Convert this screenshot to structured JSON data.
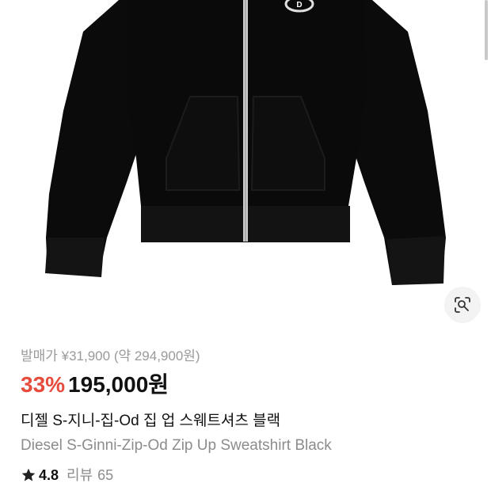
{
  "product": {
    "image_alt": "Diesel S-Ginni-Zip-Od black zip-up sweatshirt",
    "release_price": "발매가 ¥31,900 (약 294,900원)",
    "discount": "33%",
    "price": "195,000원",
    "title_ko": "디젤 S-지니-집-Od 집 업 스웨트셔츠 블랙",
    "title_en": "Diesel S-Ginni-Zip-Od Zip Up Sweatshirt Black",
    "rating": "4.8",
    "review_label": "리뷰",
    "review_count": "65"
  },
  "icons": {
    "lens": "lens-search-icon",
    "star": "star-icon"
  },
  "colors": {
    "discount": "#e64b3c",
    "garment": "#0a0a0a",
    "muted_text": "#8c8c8c"
  }
}
